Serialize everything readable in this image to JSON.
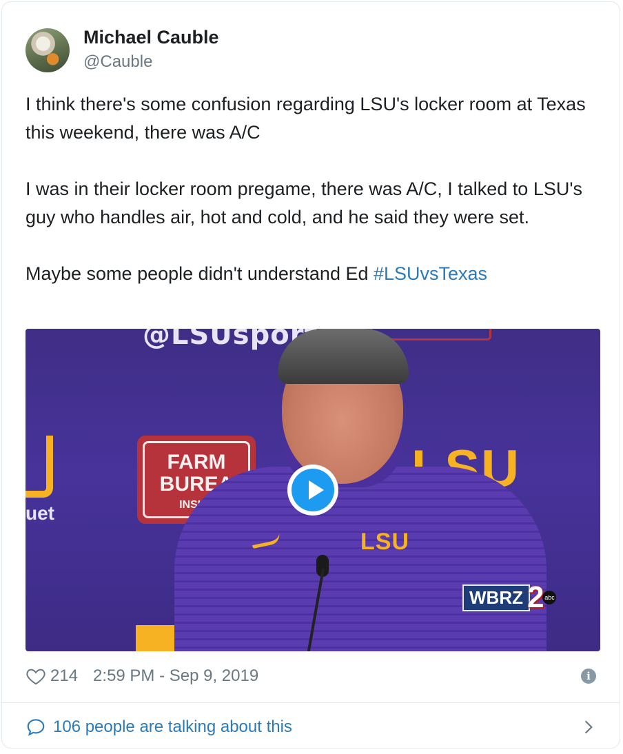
{
  "author": {
    "name": "Michael Cauble",
    "handle": "@Cauble",
    "avatar_icon": "profile-photo"
  },
  "tweet": {
    "paragraphs": [
      "I think there's some confusion regarding LSU's locker room at Texas this weekend, there was A/C",
      "I was in their locker room pregame, there was A/C, I talked to LSU's guy who handles air, hot and cold, and he said they were set."
    ],
    "last_line_text": "Maybe some people didn't understand Ed ",
    "hashtag": "#LSUvsTexas"
  },
  "media": {
    "backdrop_logo": "@LSUsports",
    "sign_line1": "FARM",
    "sign_line2": "BUREA",
    "sign_line3": "INSUR",
    "lsu_backdrop": "LSU",
    "side_text": "uet",
    "shirt_logo": "LSU",
    "watermark_station": "WBRZ",
    "watermark_channel": "2",
    "watermark_network": "abc",
    "play_icon": "play-icon"
  },
  "meta": {
    "likes": "214",
    "timestamp": "2:59 PM - Sep 9, 2019",
    "info_icon": "info-icon"
  },
  "conversation": {
    "label": "106 people are talking about this"
  },
  "colors": {
    "link": "#2b7bb9",
    "muted": "#697882",
    "play_blue": "#1d9bf0",
    "lsu_purple": "#47339a",
    "lsu_gold": "#f6b223"
  }
}
